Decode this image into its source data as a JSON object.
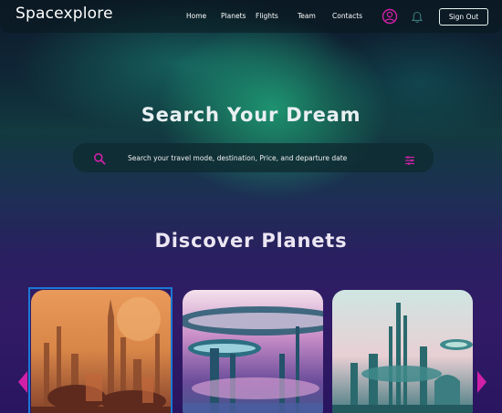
{
  "brand": {
    "name": "Spacexplore"
  },
  "nav": {
    "items": [
      {
        "label": "Home"
      },
      {
        "label": "Planets"
      },
      {
        "label": "Flights"
      },
      {
        "label": "Team"
      },
      {
        "label": "Contacts"
      }
    ],
    "sign_out_label": "Sign Out"
  },
  "hero": {
    "title": "Search Your Dream",
    "search": {
      "placeholder": "Search your travel mode, destination, Price, and departure date",
      "value": ""
    }
  },
  "planets": {
    "title": "Discover Planets",
    "cards": [
      {
        "image": "orange-desert-city-spires",
        "selected": true
      },
      {
        "image": "ringed-station-over-pink-sea",
        "selected": false
      },
      {
        "image": "teal-towers-floating-city",
        "selected": false
      }
    ]
  },
  "icons": {
    "user": "user-circle-icon",
    "notifications": "bell-icon",
    "search": "search-icon",
    "filter": "filter-sliders-icon",
    "prev": "chevron-left-icon",
    "next": "chevron-right-icon"
  },
  "colors": {
    "accent": "#d020a8",
    "selection_border": "#1a78d6",
    "aurora": "#28dc96",
    "background_bottom": "#2a1560"
  }
}
